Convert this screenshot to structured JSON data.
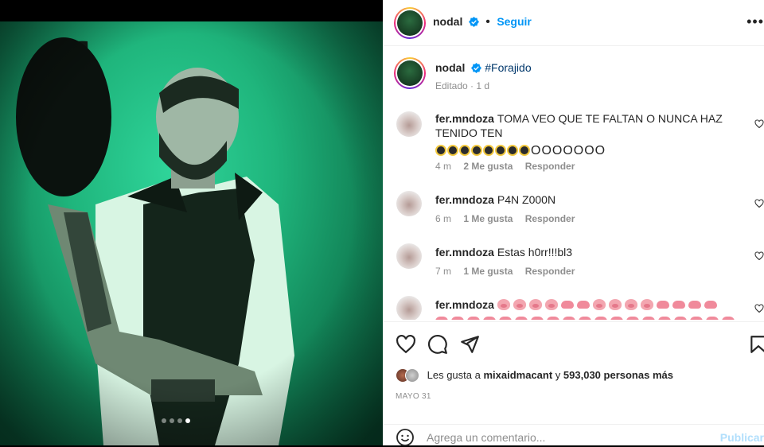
{
  "header": {
    "username": "nodal",
    "follow_label": "Seguir",
    "more_label": "•••"
  },
  "caption": {
    "username": "nodal",
    "hashtag": "#Forajido",
    "edited": "Editado",
    "time": "1 d"
  },
  "comments": [
    {
      "username": "fer.mndoza",
      "text": "TOMA VEO QUE TE FALTAN O NUNCA HAZ TENIDO TEN",
      "time": "4 m",
      "likes": "2 Me gusta",
      "reply": "Responder"
    },
    {
      "username": "fer.mndoza",
      "text": "P4N Z000N",
      "time": "6 m",
      "likes": "1 Me gusta",
      "reply": "Responder"
    },
    {
      "username": "fer.mndoza",
      "text": "Estas h0rr!!!bl3",
      "time": "7 m",
      "likes": "1 Me gusta",
      "reply": "Responder"
    },
    {
      "username": "fer.mndoza",
      "text": "",
      "time": "",
      "likes": "",
      "reply": ""
    }
  ],
  "likes": {
    "prefix": "Les gusta a",
    "user": "mixaidmacant",
    "connector": "y",
    "count": "593,030 personas más"
  },
  "date": "MAYO 31",
  "add_comment": {
    "placeholder": "Agrega un comentario...",
    "publish": "Publicar"
  },
  "carousel": {
    "total": 4,
    "active_index": 3
  },
  "colors": {
    "accent": "#0095f6",
    "link": "#00376b",
    "muted": "#8e8e8e"
  }
}
